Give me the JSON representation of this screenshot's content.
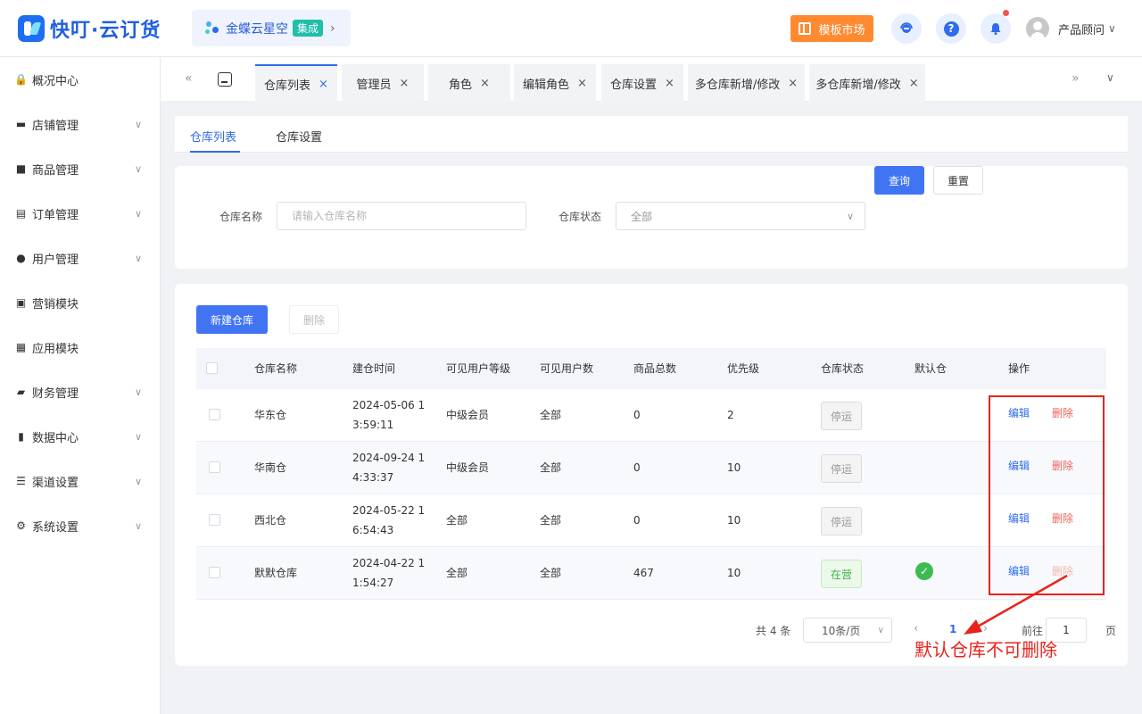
{
  "header": {
    "logo_text": "快叮·云订货",
    "brand_name": "金蝶云星空",
    "brand_badge": "集成",
    "brand_chevron": "›",
    "market_label": "模板市场",
    "help_glyph": "?",
    "user_name": "产品顾问",
    "user_chevron": "∨"
  },
  "sidebar": {
    "items": [
      {
        "label": "概况中心",
        "icon": "shop-bag-icon",
        "glyph": "🔒",
        "expandable": false
      },
      {
        "label": "店铺管理",
        "icon": "store-icon",
        "glyph": "▬",
        "expandable": true
      },
      {
        "label": "商品管理",
        "icon": "briefcase-icon",
        "glyph": "■",
        "expandable": true
      },
      {
        "label": "订单管理",
        "icon": "clipboard-icon",
        "glyph": "▤",
        "expandable": true
      },
      {
        "label": "用户管理",
        "icon": "user-icon",
        "glyph": "●",
        "expandable": true
      },
      {
        "label": "营销模块",
        "icon": "trend-icon",
        "glyph": "▣",
        "expandable": false
      },
      {
        "label": "应用模块",
        "icon": "grid-icon",
        "glyph": "▦",
        "expandable": false
      },
      {
        "label": "财务管理",
        "icon": "wallet-icon",
        "glyph": "▰",
        "expandable": true
      },
      {
        "label": "数据中心",
        "icon": "bar-chart-icon",
        "glyph": "▮",
        "expandable": true
      },
      {
        "label": "渠道设置",
        "icon": "list-icon",
        "glyph": "☰",
        "expandable": true
      },
      {
        "label": "系统设置",
        "icon": "gear-icon",
        "glyph": "⚙",
        "expandable": true
      }
    ],
    "chevron": "∨"
  },
  "tabs": {
    "nav_left": "«",
    "nav_right": "»",
    "nav_down": "∨",
    "close_glyph": "×",
    "items": [
      {
        "label": "仓库列表",
        "active": true
      },
      {
        "label": "管理员",
        "active": false
      },
      {
        "label": "角色",
        "active": false
      },
      {
        "label": "编辑角色",
        "active": false
      },
      {
        "label": "仓库设置",
        "active": false
      },
      {
        "label": "多仓库新增/修改",
        "active": false
      },
      {
        "label": "多仓库新增/修改",
        "active": false
      }
    ]
  },
  "subtabs": [
    "仓库列表",
    "仓库设置"
  ],
  "filter": {
    "name_label": "仓库名称",
    "name_placeholder": "请输入仓库名称",
    "status_label": "仓库状态",
    "status_value": "全部",
    "select_chevron": "∨",
    "query_label": "查询",
    "reset_label": "重置"
  },
  "toolbar": {
    "new_label": "新建仓库",
    "delete_label": "删除"
  },
  "table": {
    "columns": [
      "仓库名称",
      "建仓时间",
      "可见用户等级",
      "可见用户数",
      "商品总数",
      "优先级",
      "仓库状态",
      "默认仓",
      "操作"
    ],
    "rows": [
      {
        "name": "华东仓",
        "created": "2024-05-06 13:59:11",
        "level": "中级会员",
        "users": "全部",
        "goods": "0",
        "priority": "2",
        "status": "停运",
        "status_kind": "stop",
        "is_default": false,
        "default_glyph": "",
        "edit": "编辑",
        "delete": "删除"
      },
      {
        "name": "华南仓",
        "created": "2024-09-24 14:33:37",
        "level": "中级会员",
        "users": "全部",
        "goods": "0",
        "priority": "10",
        "status": "停运",
        "status_kind": "stop",
        "is_default": false,
        "default_glyph": "",
        "edit": "编辑",
        "delete": "删除"
      },
      {
        "name": "西北仓",
        "created": "2024-05-22 16:54:43",
        "level": "全部",
        "users": "全部",
        "goods": "0",
        "priority": "10",
        "status": "停运",
        "status_kind": "stop",
        "is_default": false,
        "default_glyph": "",
        "edit": "编辑",
        "delete": "删除"
      },
      {
        "name": "默默仓库",
        "created": "2024-04-22 11:54:27",
        "level": "全部",
        "users": "全部",
        "goods": "467",
        "priority": "10",
        "status": "在营",
        "status_kind": "run",
        "is_default": true,
        "default_glyph": "✓",
        "edit": "编辑",
        "delete": "删除"
      }
    ]
  },
  "pager": {
    "total": "共 4 条",
    "page_size": "10条/页",
    "size_chevron": "∨",
    "prev": "‹",
    "current": "1",
    "next": "›",
    "goto_label": "前往",
    "goto_value": "1",
    "page_suffix": "页"
  },
  "annotation": {
    "text": "默认仓库不可删除",
    "color": "#e8231c"
  },
  "colors": {
    "primary": "#4174f3",
    "accent_text": "#2f6bec",
    "danger": "#f0635b",
    "success": "#3dbb52",
    "market": "#ff8a30"
  }
}
